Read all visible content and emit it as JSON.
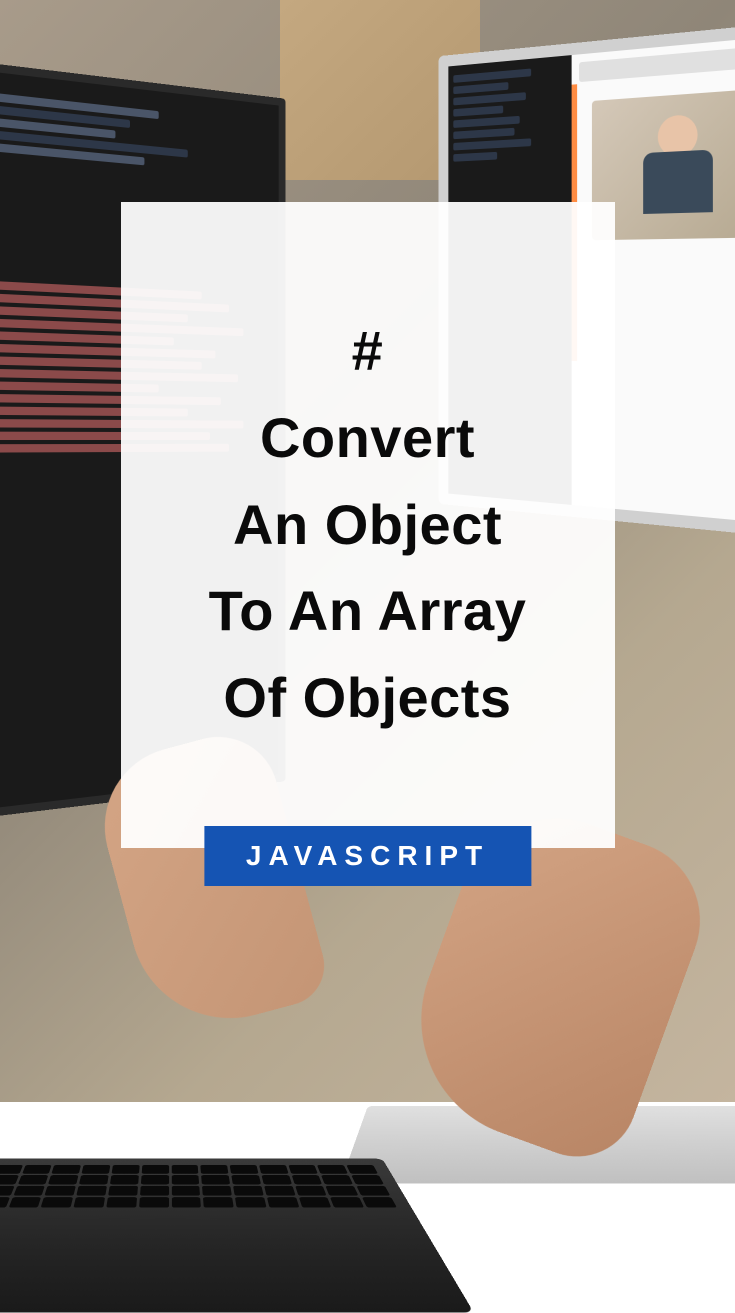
{
  "title": {
    "line1": "#",
    "line2": "Convert",
    "line3": "An Object",
    "line4": "To An Array",
    "line5": "Of Objects"
  },
  "badge": {
    "label": "JAVASCRIPT"
  }
}
